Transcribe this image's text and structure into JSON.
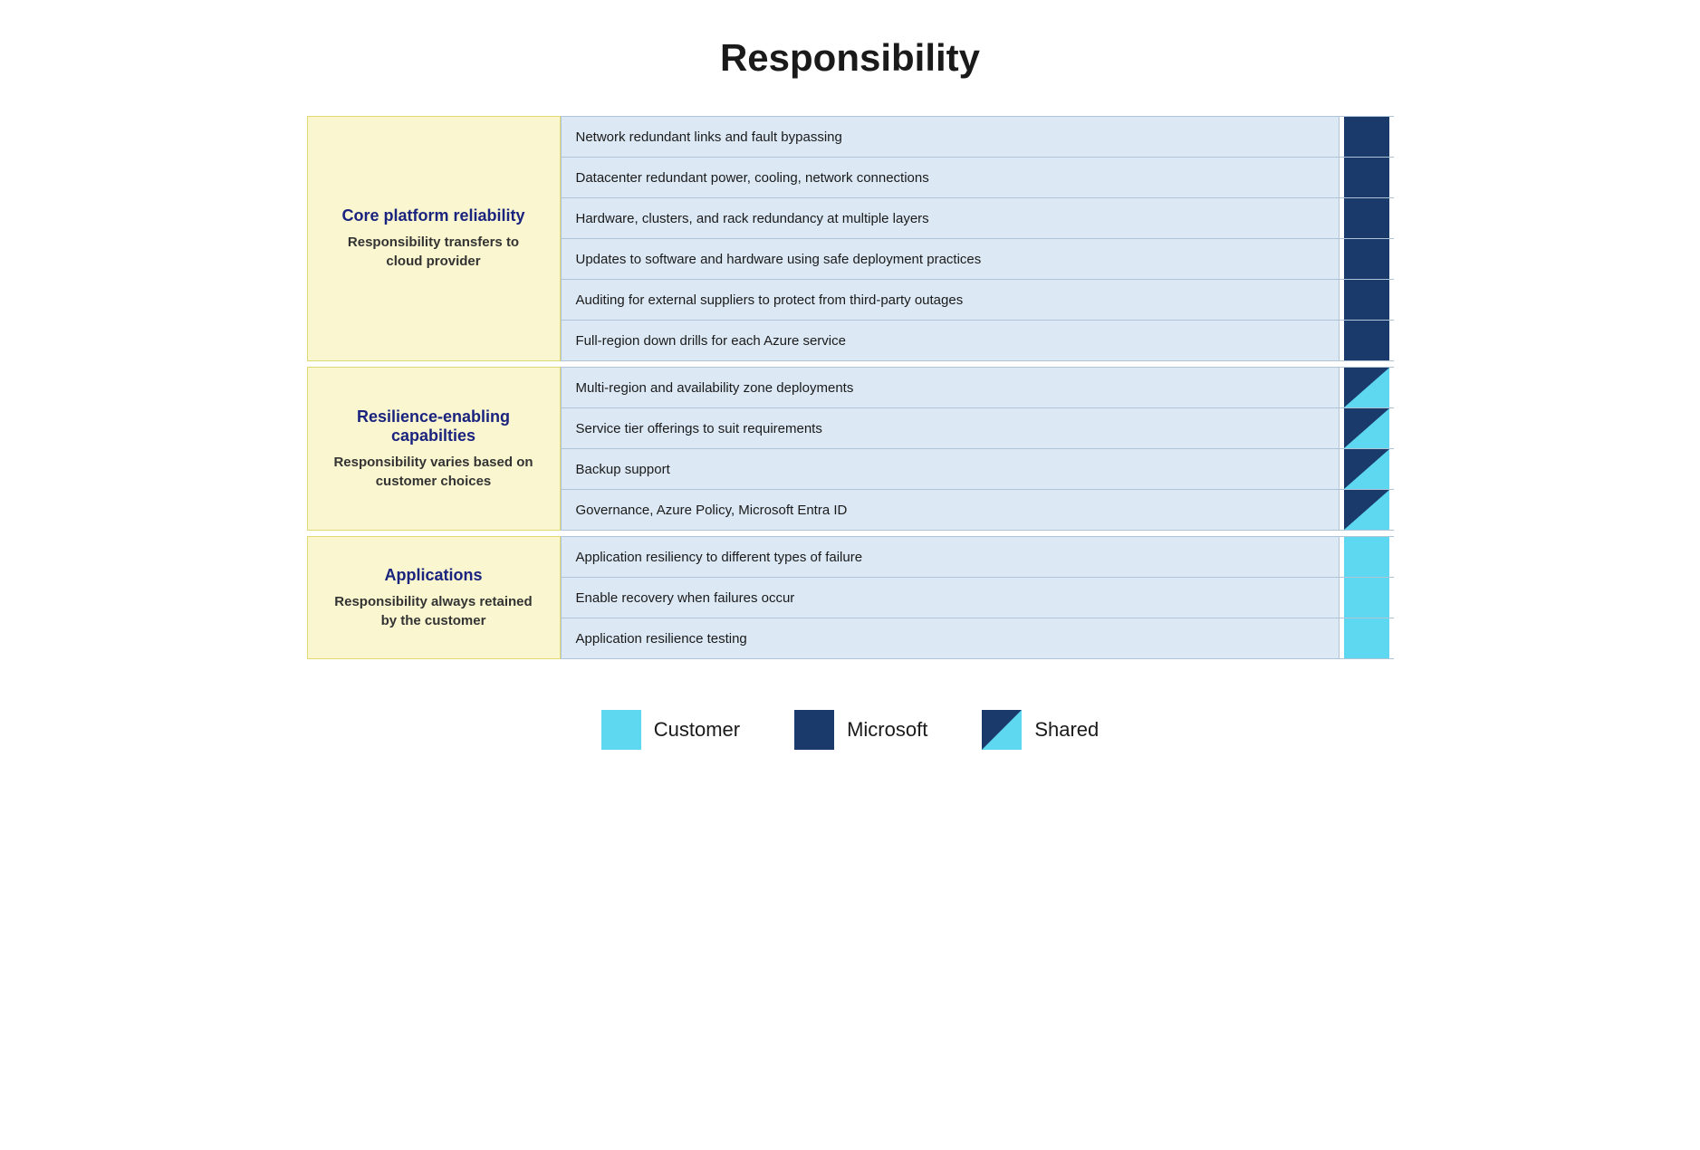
{
  "title": "Responsibility",
  "sections": [
    {
      "id": "core-platform",
      "label_title": "Core platform reliability",
      "label_subtitle": "Responsibility transfers\nto cloud provider",
      "items": [
        {
          "text": "Network redundant links and fault bypassing",
          "indicator": "microsoft"
        },
        {
          "text": "Datacenter redundant power, cooling, network connections",
          "indicator": "microsoft"
        },
        {
          "text": "Hardware, clusters, and rack redundancy at multiple layers",
          "indicator": "microsoft"
        },
        {
          "text": "Updates to software and hardware using safe deployment practices",
          "indicator": "microsoft"
        },
        {
          "text": "Auditing for external suppliers to protect from third-party outages",
          "indicator": "microsoft"
        },
        {
          "text": "Full-region down drills for each Azure service",
          "indicator": "microsoft"
        }
      ]
    },
    {
      "id": "resilience-enabling",
      "label_title": "Resilience-enabling capabilties",
      "label_subtitle": "Responsibility varies based\non customer choices",
      "items": [
        {
          "text": "Multi-region and availability zone deployments",
          "indicator": "shared"
        },
        {
          "text": "Service tier offerings to suit requirements",
          "indicator": "shared"
        },
        {
          "text": "Backup support",
          "indicator": "shared"
        },
        {
          "text": "Governance, Azure Policy, Microsoft Entra ID",
          "indicator": "shared"
        }
      ]
    },
    {
      "id": "applications",
      "label_title": "Applications",
      "label_subtitle": "Responsibility always\nretained by the customer",
      "items": [
        {
          "text": "Application resiliency to different types of failure",
          "indicator": "customer"
        },
        {
          "text": "Enable recovery when failures occur",
          "indicator": "customer"
        },
        {
          "text": "Application resilience testing",
          "indicator": "customer"
        }
      ]
    }
  ],
  "legend": {
    "items": [
      {
        "id": "customer",
        "type": "customer",
        "label": "Customer"
      },
      {
        "id": "microsoft",
        "type": "microsoft",
        "label": "Microsoft"
      },
      {
        "id": "shared",
        "type": "shared",
        "label": "Shared"
      }
    ]
  }
}
